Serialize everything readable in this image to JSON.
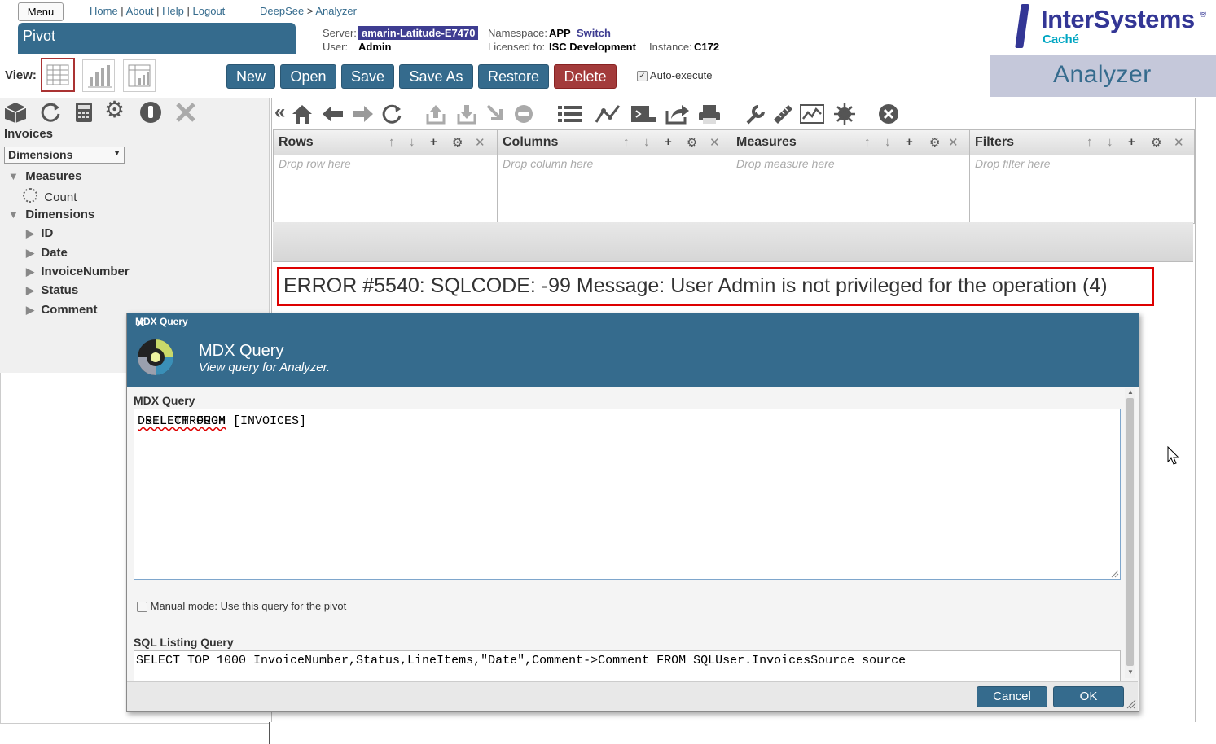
{
  "header": {
    "menu_label": "Menu",
    "links": [
      "Home",
      "About",
      "Help",
      "Logout"
    ],
    "breadcrumb": [
      "DeepSee",
      "Analyzer"
    ],
    "breadcrumb_sep": ">",
    "page_tab": "Pivot",
    "server_label": "Server:",
    "server_value": "amarin-Latitude-E7470",
    "namespace_label": "Namespace:",
    "namespace_value": "APP",
    "switch_label": "Switch",
    "user_label": "User:",
    "user_value": "Admin",
    "licensed_label": "Licensed to:",
    "licensed_value": "ISC Development",
    "instance_label": "Instance:",
    "instance_value": "C172",
    "logo_text": "InterSystems",
    "logo_sub": "Caché",
    "logo_reg": "®"
  },
  "toolbar": {
    "view_label": "View:",
    "buttons": {
      "new": "New",
      "open": "Open",
      "save": "Save",
      "save_as": "Save As",
      "restore": "Restore",
      "delete": "Delete"
    },
    "auto_execute_label": "Auto-execute",
    "auto_execute_checked": true,
    "app_title": "Analyzer"
  },
  "left_panel": {
    "cube_name": "Invoices",
    "select_value": "Dimensions",
    "tree": {
      "measures_label": "Measures",
      "measures": [
        "Count"
      ],
      "dimensions_label": "Dimensions",
      "dimensions": [
        "ID",
        "Date",
        "InvoiceNumber",
        "Status",
        "Comment"
      ]
    }
  },
  "work_area": {
    "collapse_label": "«",
    "drop_zones": [
      {
        "name": "Rows",
        "placeholder": "Drop row here"
      },
      {
        "name": "Columns",
        "placeholder": "Drop column here"
      },
      {
        "name": "Measures",
        "placeholder": "Drop measure here"
      },
      {
        "name": "Filters",
        "placeholder": "Drop filter here"
      }
    ],
    "error_message": "ERROR #5540: SQLCODE: -99 Message: User Admin is not privileged for the operation (4)"
  },
  "dialog": {
    "title_bar": "MDX Query",
    "heading": "MDX Query",
    "subheading": "View query for Analyzer.",
    "mdx_label": "MDX Query",
    "mdx_query_keyword": "DRILLTHROUGH",
    "mdx_query_rest": " SELECT FROM [INVOICES]",
    "manual_mode_label": "Manual mode: Use this query for the pivot",
    "manual_mode_checked": false,
    "sql_label": "SQL Listing Query",
    "sql_query": "SELECT TOP 1000 InvoiceNumber,Status,LineItems,\"Date\",Comment->Comment FROM SQLUser.InvoicesSource source",
    "cancel_label": "Cancel",
    "ok_label": "OK"
  },
  "colors": {
    "brand_blue": "#356b8d",
    "delete_red": "#a33b3b",
    "error_red": "#dd0000",
    "server_badge": "#3e3d91"
  }
}
